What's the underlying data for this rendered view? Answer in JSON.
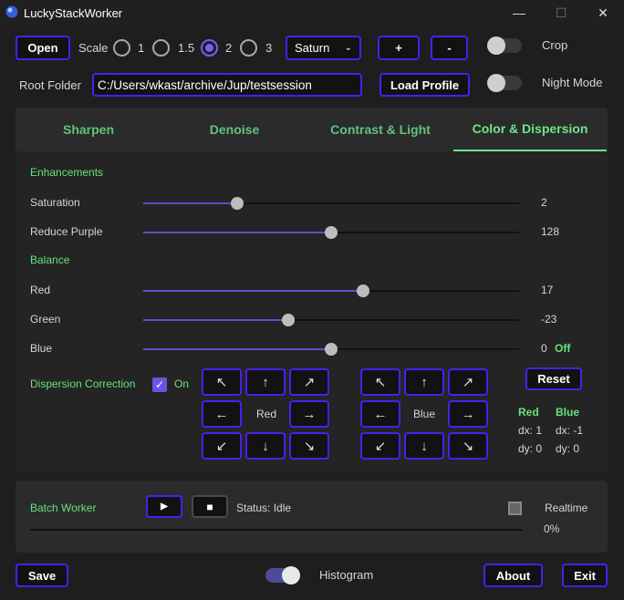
{
  "window": {
    "title": "LuckyStackWorker",
    "minimize": "—",
    "maximize": "☐",
    "close": "✕"
  },
  "top": {
    "open_label": "Open",
    "scale_label": "Scale",
    "scale_options": [
      "1",
      "1.5",
      "2",
      "3"
    ],
    "scale_selected": "2",
    "profile_value": "Saturn",
    "plus_label": "+",
    "minus_label": "-",
    "crop_label": "Crop",
    "root_folder_label": "Root Folder",
    "root_folder_value": "C:/Users/wkast/archive/Jup/testsession",
    "load_profile_label": "Load Profile",
    "night_mode_label": "Night Mode"
  },
  "tabs": [
    "Sharpen",
    "Denoise",
    "Contrast & Light",
    "Color & Dispersion"
  ],
  "active_tab": "Color & Dispersion",
  "enhancements": {
    "heading": "Enhancements",
    "saturation": {
      "label": "Saturation",
      "value": "2",
      "fraction": 0.25
    },
    "reduce_purple": {
      "label": "Reduce Purple",
      "value": "128",
      "fraction": 0.5
    }
  },
  "balance": {
    "heading": "Balance",
    "red": {
      "label": "Red",
      "value": "17",
      "fraction": 0.585
    },
    "green": {
      "label": "Green",
      "value": "-23",
      "fraction": 0.385
    },
    "blue": {
      "label": "Blue",
      "value": "0",
      "fraction": 0.5,
      "status": "Off"
    }
  },
  "dispersion": {
    "label": "Dispersion Correction",
    "on_label": "On",
    "red_label": "Red",
    "blue_label": "Blue",
    "reset_label": "Reset",
    "arrows": {
      "up_left": "↖",
      "up": "↑",
      "up_right": "↗",
      "left": "←",
      "right": "→",
      "down_left": "↙",
      "down": "↓",
      "down_right": "↘"
    },
    "red_offsets": {
      "title": "Red",
      "dx": "dx: 1",
      "dy": "dy: 0"
    },
    "blue_offsets": {
      "title": "Blue",
      "dx": "dx: -1",
      "dy": "dy: 0"
    }
  },
  "batch": {
    "label": "Batch Worker",
    "play_icon": "▶",
    "stop_icon": "■",
    "status": "Status: Idle",
    "realtime_label": "Realtime",
    "progress_text": "0%",
    "progress": 0
  },
  "bottom": {
    "save_label": "Save",
    "histogram_label": "Histogram",
    "about_label": "About",
    "exit_label": "Exit"
  },
  "colors": {
    "accent_border": "#4b1ef0",
    "green_text": "#67e27e",
    "slider_fill": "#5d4ec9"
  }
}
